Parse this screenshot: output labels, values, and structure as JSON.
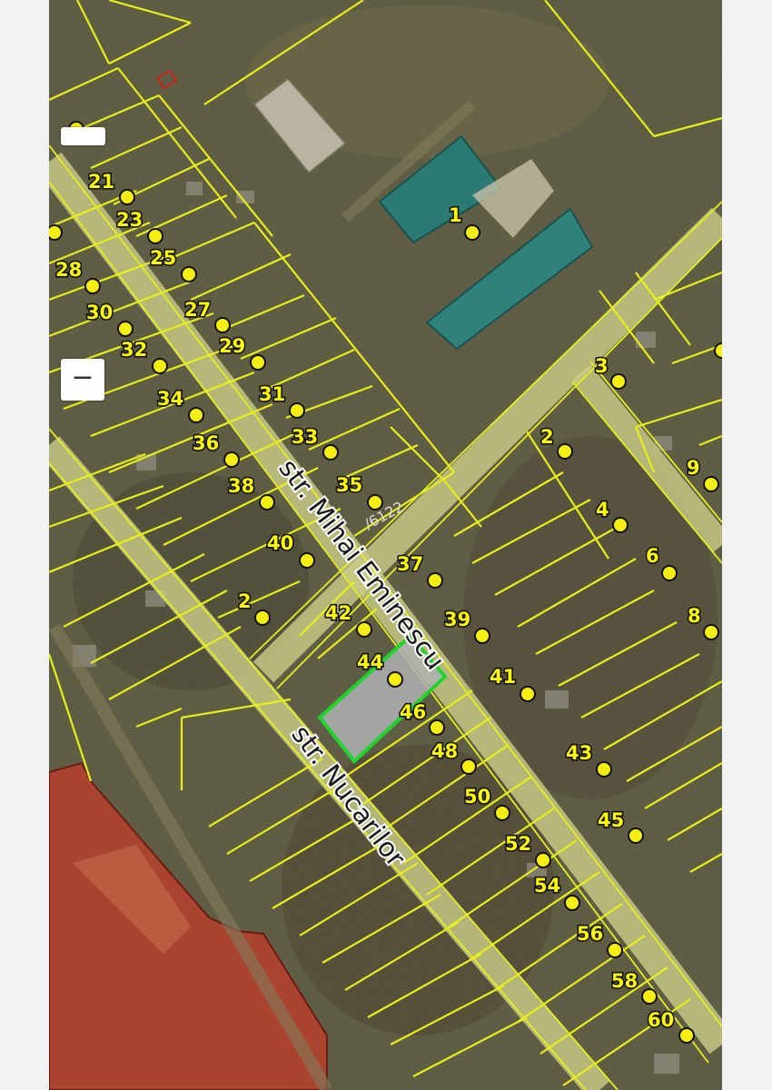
{
  "map": {
    "parcel_code": "/6122",
    "streets": [
      "str. Mihai Eminescu",
      "str. Nucarilor"
    ],
    "house_numbers": [
      "1",
      "2",
      "2",
      "3",
      "4",
      "6",
      "8",
      "9",
      "21",
      "23",
      "25",
      "27",
      "28",
      "29",
      "30",
      "31",
      "32",
      "33",
      "34",
      "35",
      "36",
      "37",
      "38",
      "39",
      "40",
      "41",
      "42",
      "43",
      "44",
      "45",
      "46",
      "48",
      "50",
      "52",
      "54",
      "56",
      "58",
      "60"
    ],
    "colors": {
      "parcel_boundary": "#e8ee1a",
      "selected_parcel": "#22d22e",
      "address_point": "#f6ee10",
      "industrial_zone": "#a9452f",
      "road": "#c9cc86",
      "label_text": "#fffb00"
    },
    "selected_parcel_house_number": "44"
  },
  "controls": {
    "zoom_in_label": "",
    "zoom_out_label": "−"
  }
}
